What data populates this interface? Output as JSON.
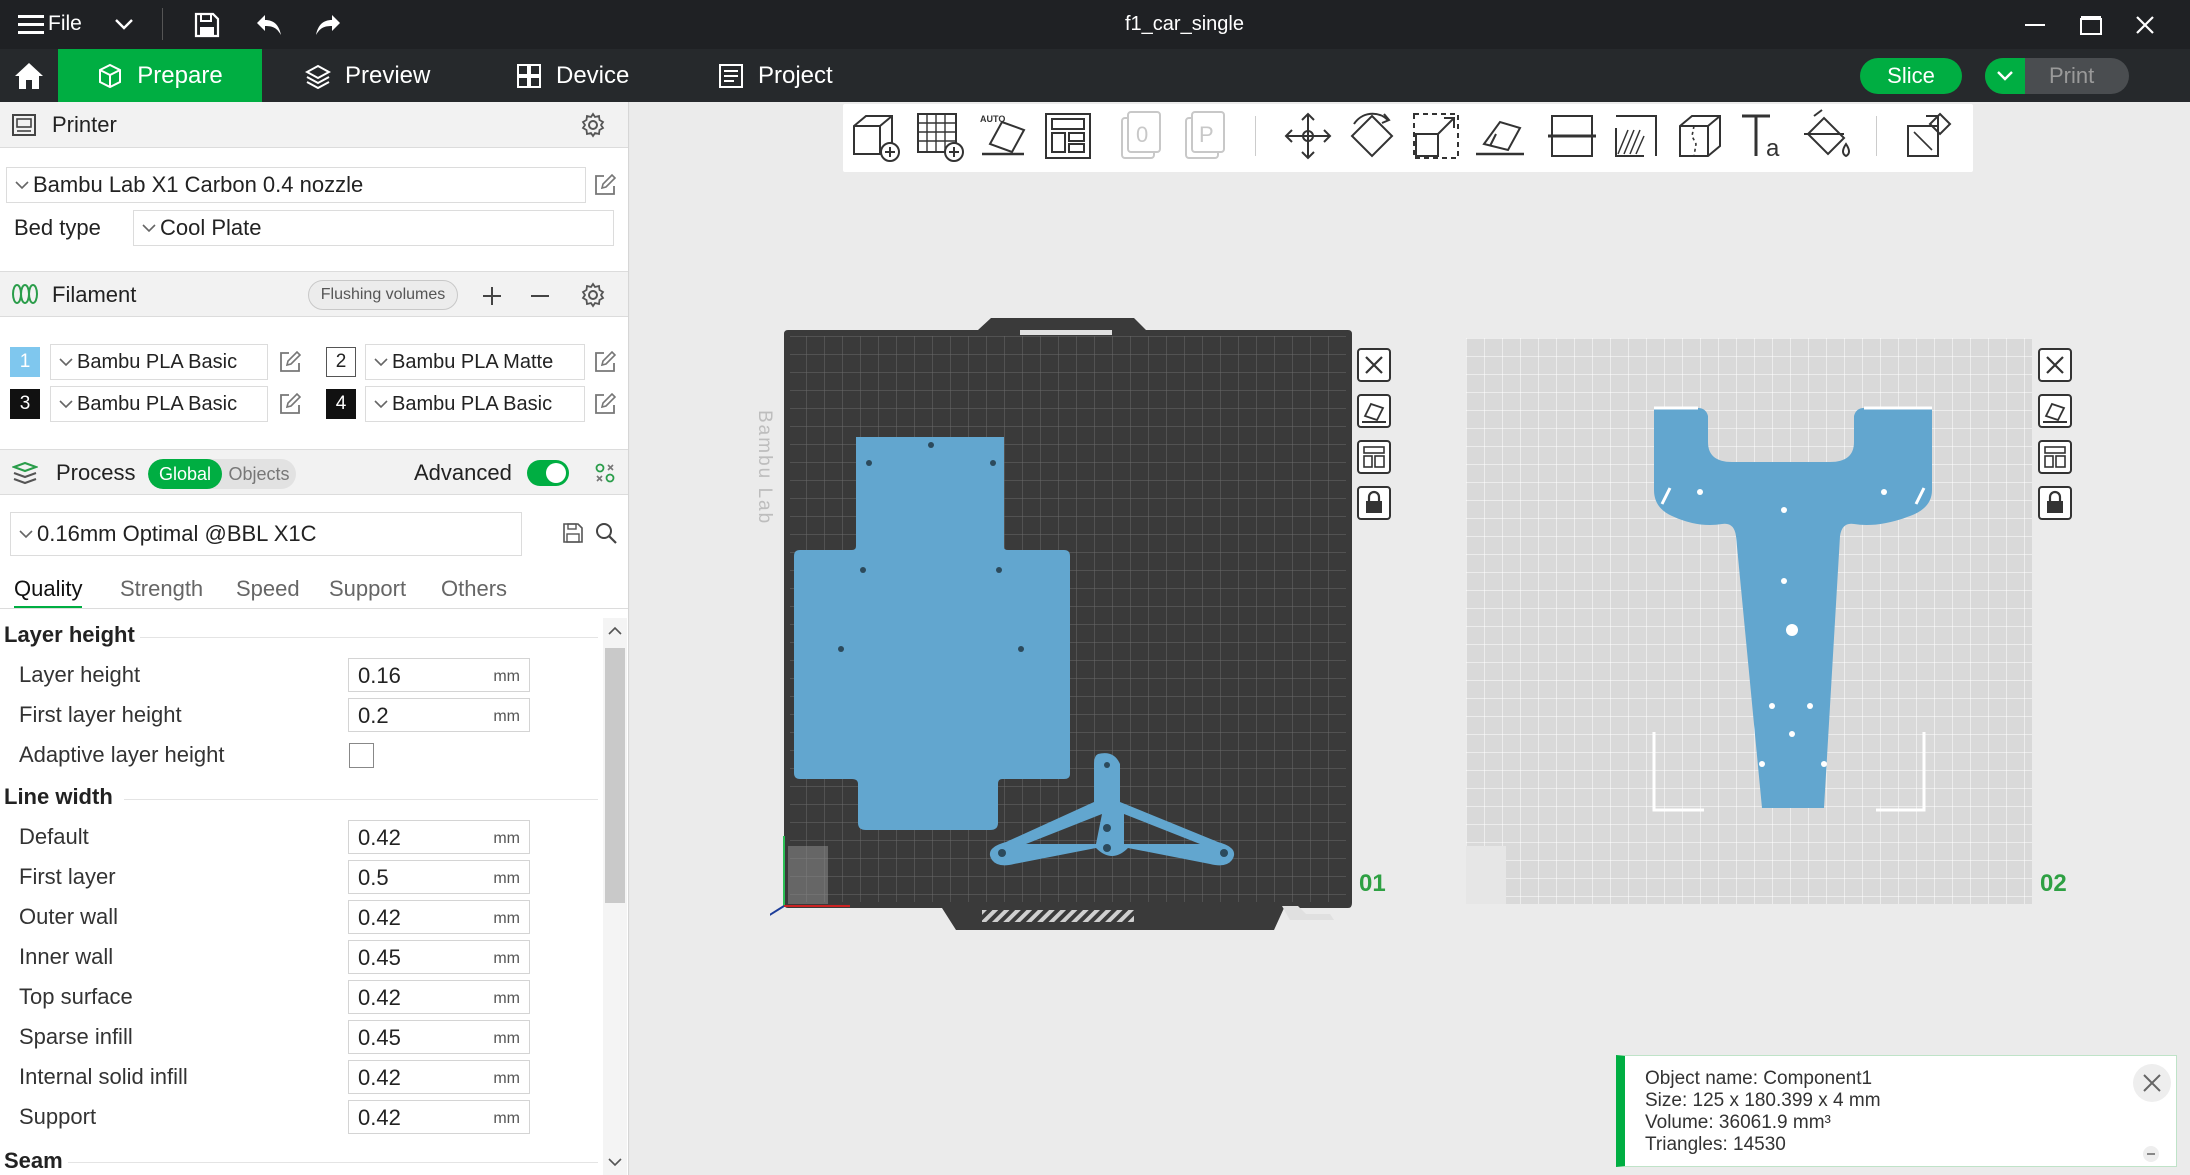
{
  "window": {
    "title": "f1_car_single",
    "file_menu": "File"
  },
  "nav": {
    "tabs": [
      {
        "label": "Prepare",
        "active": true
      },
      {
        "label": "Preview"
      },
      {
        "label": "Device"
      },
      {
        "label": "Project"
      }
    ],
    "slice": "Slice",
    "print": "Print"
  },
  "printer": {
    "header": "Printer",
    "model": "Bambu Lab X1 Carbon 0.4 nozzle",
    "bed_type_label": "Bed type",
    "bed_type": "Cool Plate"
  },
  "filament": {
    "header": "Filament",
    "flushing_button": "Flushing volumes",
    "items": [
      {
        "index": "1",
        "name": "Bambu PLA Basic",
        "color": "#7fc7ee"
      },
      {
        "index": "2",
        "name": "Bambu PLA Matte",
        "color": "#ffffff"
      },
      {
        "index": "3",
        "name": "Bambu PLA Basic",
        "color": "#111111"
      },
      {
        "index": "4",
        "name": "Bambu PLA Basic",
        "color": "#111111"
      }
    ]
  },
  "process": {
    "header": "Process",
    "toggle_global": "Global",
    "toggle_objects": "Objects",
    "advanced_label": "Advanced",
    "preset": "0.16mm Optimal @BBL X1C",
    "tabs": [
      "Quality",
      "Strength",
      "Speed",
      "Support",
      "Others"
    ],
    "groups": {
      "layer_height": "Layer height",
      "line_width": "Line width",
      "seam": "Seam"
    },
    "layer_height": {
      "rows": [
        {
          "label": "Layer height",
          "value": "0.16",
          "unit": "mm"
        },
        {
          "label": "First layer height",
          "value": "0.2",
          "unit": "mm"
        }
      ],
      "adaptive_label": "Adaptive layer height"
    },
    "line_width": {
      "rows": [
        {
          "label": "Default",
          "value": "0.42",
          "unit": "mm"
        },
        {
          "label": "First layer",
          "value": "0.5",
          "unit": "mm"
        },
        {
          "label": "Outer wall",
          "value": "0.42",
          "unit": "mm"
        },
        {
          "label": "Inner wall",
          "value": "0.45",
          "unit": "mm"
        },
        {
          "label": "Top surface",
          "value": "0.42",
          "unit": "mm"
        },
        {
          "label": "Sparse infill",
          "value": "0.45",
          "unit": "mm"
        },
        {
          "label": "Internal solid infill",
          "value": "0.42",
          "unit": "mm"
        },
        {
          "label": "Support",
          "value": "0.42",
          "unit": "mm"
        }
      ]
    }
  },
  "canvas": {
    "plate1_label": "01",
    "plate2_label": "02",
    "bed_brand": "Bambu Lab",
    "model_color": "#62a6cf"
  },
  "info": {
    "object_name": "Object name: Component1",
    "size": "Size: 125 x 180.399 x 4 mm",
    "volume": "Volume: 36061.9 mm³",
    "triangles": "Triangles: 14530"
  },
  "colors": {
    "accent": "#00ae42",
    "title_bg": "#1f2124",
    "nav_bg": "#26292c"
  }
}
